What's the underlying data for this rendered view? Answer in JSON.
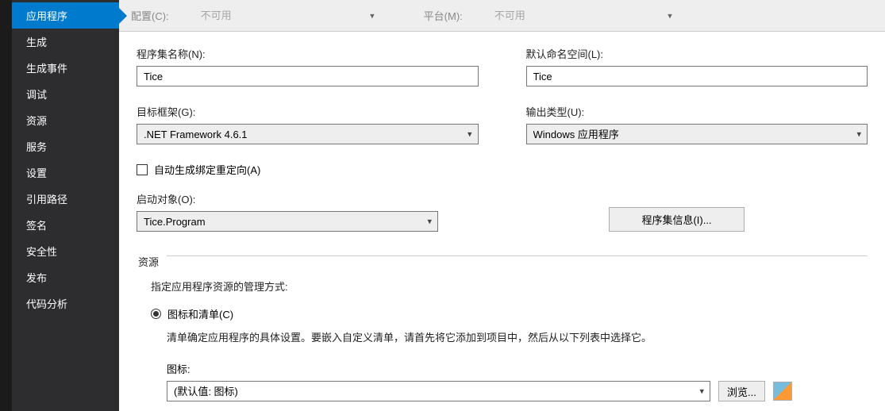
{
  "sidebar": {
    "items": [
      {
        "label": "应用程序",
        "active": true
      },
      {
        "label": "生成"
      },
      {
        "label": "生成事件"
      },
      {
        "label": "调试"
      },
      {
        "label": "资源"
      },
      {
        "label": "服务"
      },
      {
        "label": "设置"
      },
      {
        "label": "引用路径"
      },
      {
        "label": "签名"
      },
      {
        "label": "安全性"
      },
      {
        "label": "发布"
      },
      {
        "label": "代码分析"
      }
    ]
  },
  "header": {
    "config_label": "配置(C):",
    "config_value": "不可用",
    "platform_label": "平台(M):",
    "platform_value": "不可用"
  },
  "assembly_name": {
    "label": "程序集名称(N):",
    "value": "Tice"
  },
  "default_namespace": {
    "label": "默认命名空间(L):",
    "value": "Tice"
  },
  "target_framework": {
    "label": "目标框架(G):",
    "value": ".NET Framework 4.6.1"
  },
  "output_type": {
    "label": "输出类型(U):",
    "value": "Windows 应用程序"
  },
  "auto_redirect": {
    "label": "自动生成绑定重定向(A)",
    "checked": false
  },
  "startup_object": {
    "label": "启动对象(O):",
    "value": "Tice.Program"
  },
  "assembly_info_btn": "程序集信息(I)...",
  "resources": {
    "group_title": "资源",
    "description": "指定应用程序资源的管理方式:",
    "radio_label": "图标和清单(C)",
    "radio_desc": "清单确定应用程序的具体设置。要嵌入自定义清单，请首先将它添加到项目中，然后从以下列表中选择它。",
    "icon_label": "图标:",
    "icon_value": "(默认值: 图标)",
    "browse_btn": "浏览..."
  }
}
